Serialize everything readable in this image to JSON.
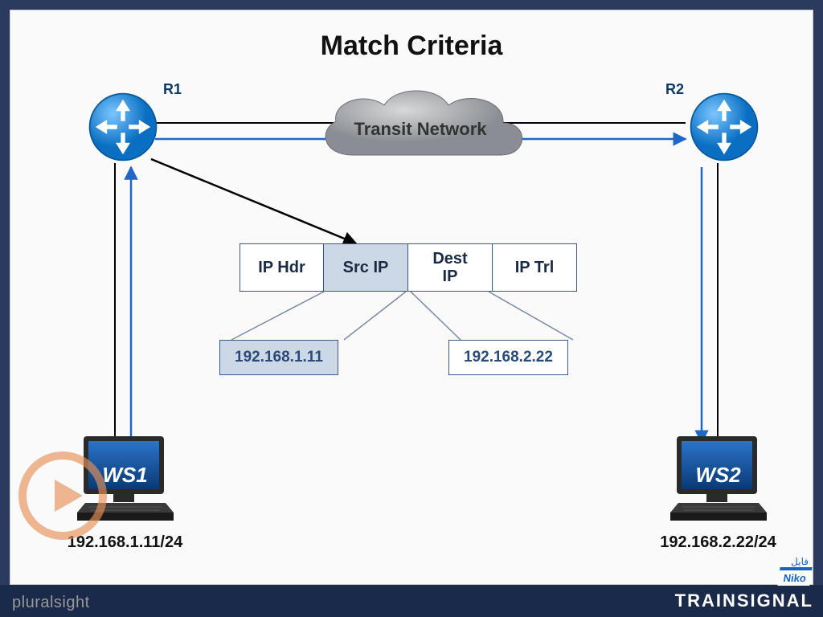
{
  "title": "Match Criteria",
  "cloud_label": "Transit Network",
  "routers": {
    "r1": "R1",
    "r2": "R2"
  },
  "workstations": {
    "ws1": {
      "label": "WS1",
      "ip": "192.168.1.11/24"
    },
    "ws2": {
      "label": "WS2",
      "ip": "192.168.2.22/24"
    }
  },
  "packet_fields": {
    "ip_hdr": "IP Hdr",
    "src_ip": "Src IP",
    "dest_ip": "Dest\nIP",
    "ip_trl": "IP Trl"
  },
  "addresses": {
    "src": "192.168.1.11",
    "dst": "192.168.2.22"
  },
  "footer": {
    "pluralsight": "pluralsight",
    "brand": "TRAINSIGNAL",
    "niko": "Niko",
    "niko_ar": "فایل"
  }
}
